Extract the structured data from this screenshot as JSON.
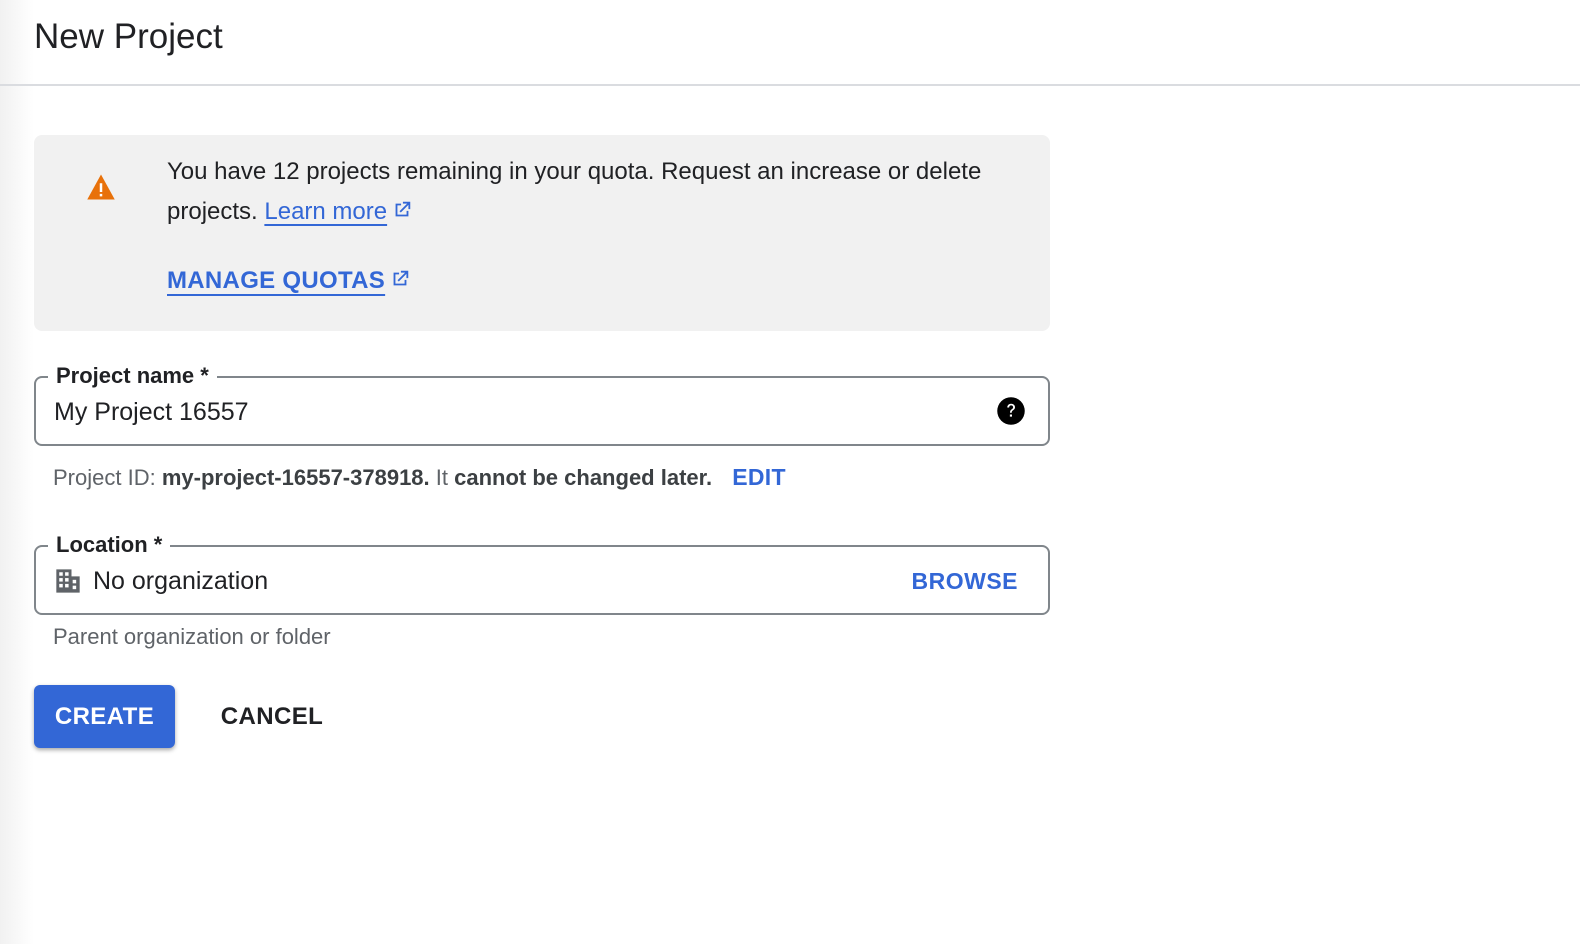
{
  "header": {
    "title": "New Project"
  },
  "quota_banner": {
    "icon": "warning-triangle-icon",
    "icon_color": "#e8710a",
    "message": "You have 12 projects remaining in your quota. Request an increase or delete projects.",
    "learn_more_label": "Learn more",
    "manage_quotas_label": "MANAGE QUOTAS",
    "link_icon": "open-in-new-icon"
  },
  "project_name_field": {
    "label": "Project name *",
    "value": "My Project 16557",
    "help_icon": "help-circle-icon"
  },
  "project_id": {
    "prefix": "Project ID:",
    "id": "my-project-16557-378918.",
    "mid": "It",
    "suffix": "cannot be changed later.",
    "edit_label": "EDIT"
  },
  "location_field": {
    "label": "Location *",
    "icon": "building-icon",
    "value": "No organization",
    "browse_label": "BROWSE",
    "helper": "Parent organization or folder"
  },
  "actions": {
    "create_label": "CREATE",
    "cancel_label": "CANCEL"
  },
  "colors": {
    "accent": "#3367d6",
    "banner_bg": "#f1f1f1",
    "warning": "#e8710a"
  }
}
